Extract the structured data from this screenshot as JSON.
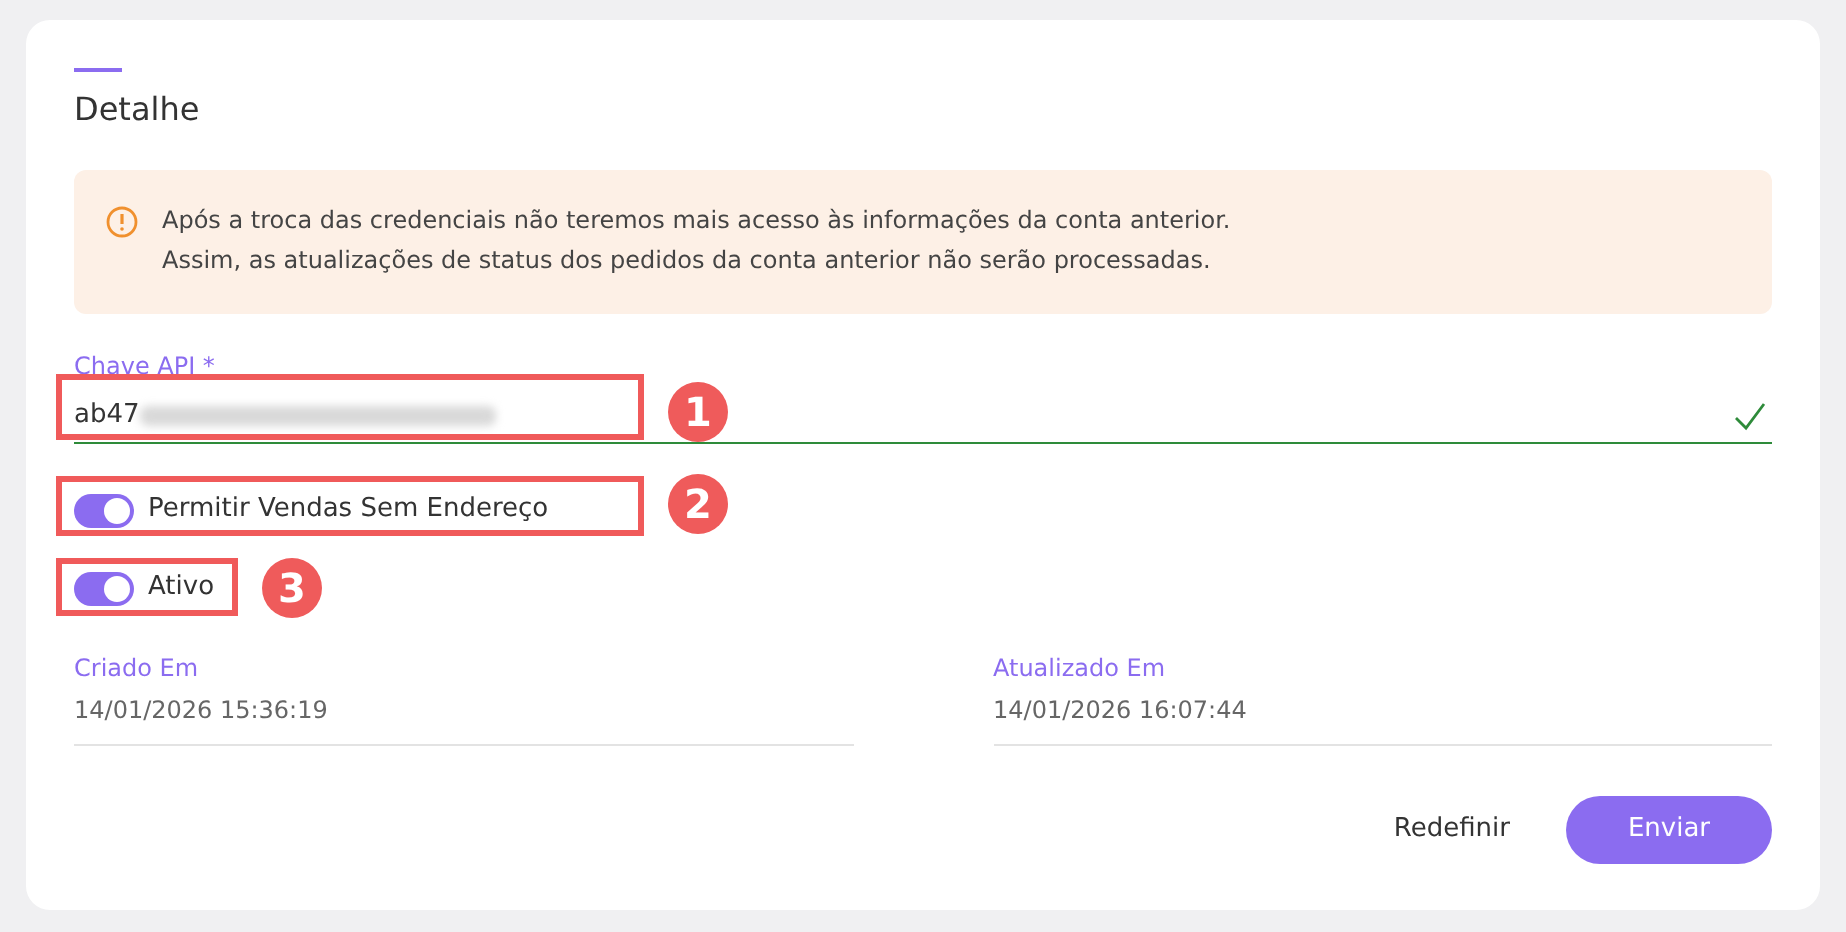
{
  "title": "Detalhe",
  "alert": {
    "lines": [
      "Após a troca das credenciais não teremos mais acesso às informações da conta anterior.",
      "Assim, as atualizações de status dos pedidos da conta anterior não serão processadas."
    ]
  },
  "api_key": {
    "label": "Chave API *",
    "value": "ab47",
    "redacted": true,
    "valid": true
  },
  "toggles": [
    {
      "label": "Permitir Vendas Sem Endereço",
      "on": true
    },
    {
      "label": "Ativo",
      "on": true
    }
  ],
  "dates": [
    {
      "label": "Criado Em",
      "value": "14/01/2026 15:36:19"
    },
    {
      "label": "Atualizado Em",
      "value": "14/01/2026 16:07:44"
    }
  ],
  "buttons": [
    {
      "label": "Redefinir",
      "kind": "text"
    },
    {
      "label": "Enviar",
      "kind": "primary"
    }
  ],
  "annotations": [
    {
      "label": "1"
    },
    {
      "label": "2"
    },
    {
      "label": "3"
    }
  ]
}
